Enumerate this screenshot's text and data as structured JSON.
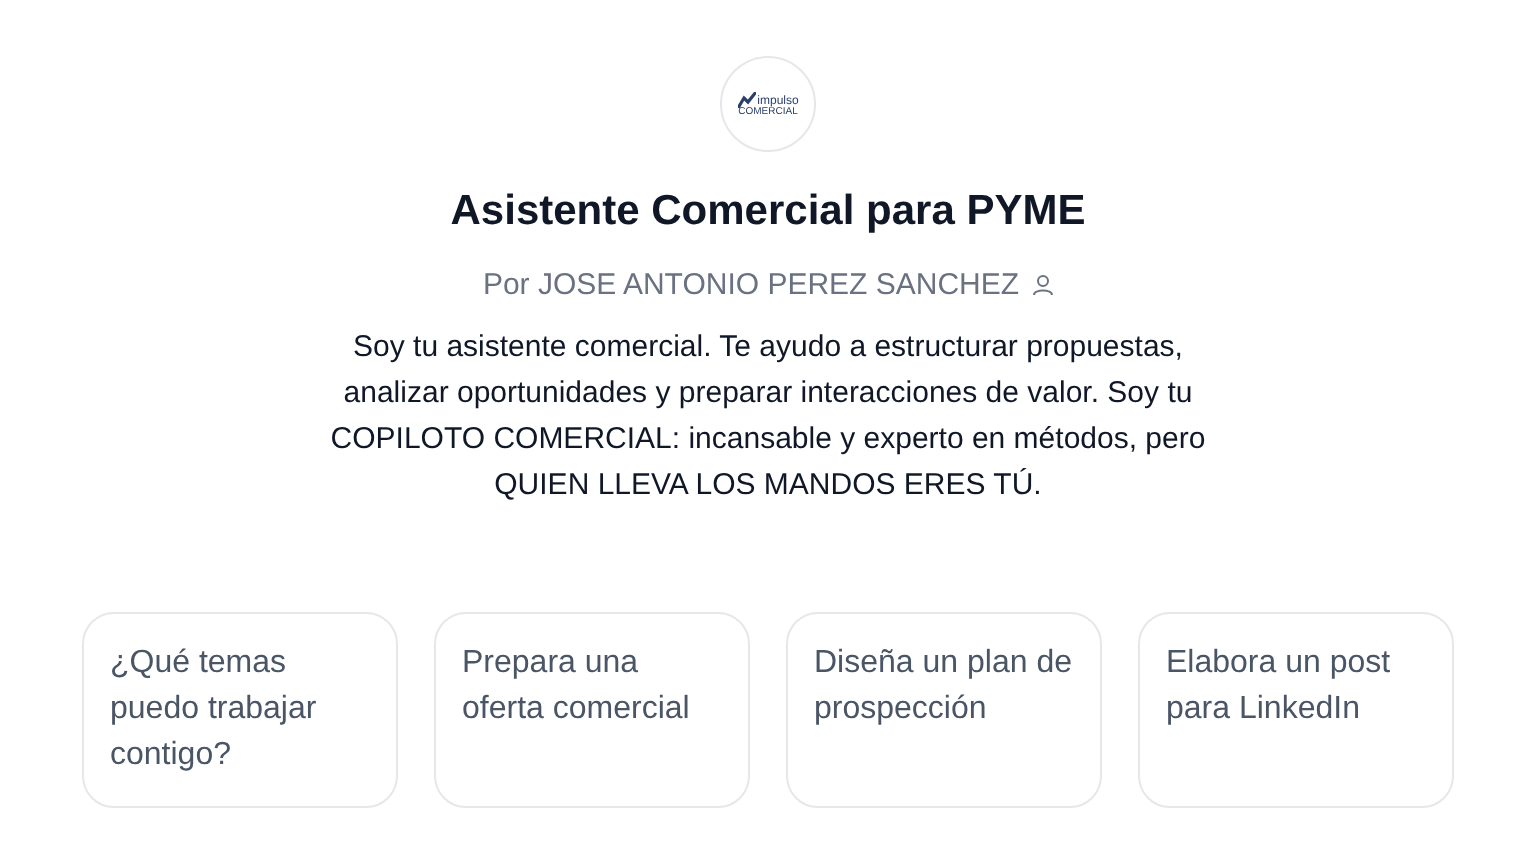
{
  "logo": {
    "line_1": "impulso",
    "line_2": "COMERCIAL"
  },
  "title": "Asistente Comercial para PYME",
  "byline": "Por JOSE ANTONIO PEREZ SANCHEZ",
  "description": "Soy tu asistente comercial. Te ayudo a estructurar propuestas, analizar oportunidades y preparar interacciones de valor. Soy tu COPILOTO COMERCIAL: incansable y experto en métodos, pero QUIEN LLEVA LOS MANDOS ERES TÚ.",
  "suggestions": [
    {
      "label": "¿Qué temas puedo trabajar contigo?"
    },
    {
      "label": "Prepara una oferta comercial"
    },
    {
      "label": "Diseña un plan de prospección"
    },
    {
      "label": "Elabora un post para LinkedIn"
    }
  ]
}
